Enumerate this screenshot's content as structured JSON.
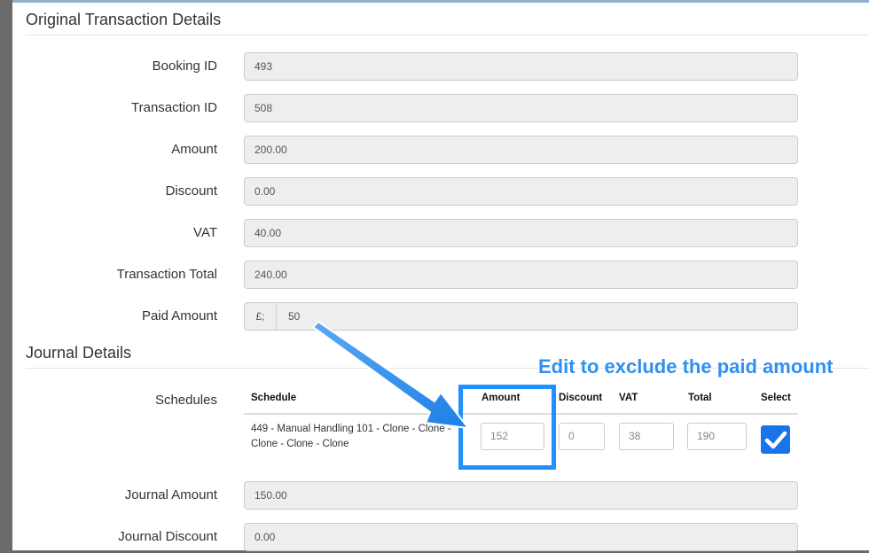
{
  "original": {
    "title": "Original Transaction Details",
    "fields": [
      {
        "label": "Booking ID",
        "value": "493"
      },
      {
        "label": "Transaction ID",
        "value": "508"
      },
      {
        "label": "Amount",
        "value": "200.00"
      },
      {
        "label": "Discount",
        "value": "0.00"
      },
      {
        "label": "VAT",
        "value": "40.00"
      },
      {
        "label": "Transaction Total",
        "value": "240.00"
      }
    ],
    "paid": {
      "label": "Paid Amount",
      "addon": "£;",
      "value": "50"
    }
  },
  "journal": {
    "title": "Journal Details",
    "schedules_label": "Schedules",
    "table": {
      "headers": [
        "Schedule",
        "Amount",
        "Discount",
        "VAT",
        "Total",
        "Select"
      ],
      "row": {
        "schedule": "449 - Manual Handling 101 - Clone - Clone - Clone - Clone - Clone",
        "amount": "152",
        "discount": "0",
        "vat": "38",
        "total": "190",
        "selected": true
      }
    },
    "fields": [
      {
        "label": "Journal Amount",
        "value": "150.00"
      },
      {
        "label": "Journal Discount",
        "value": "0.00"
      }
    ]
  },
  "annotation": {
    "text": "Edit to exclude the paid amount",
    "color": "#2f8ff2"
  },
  "colors": {
    "accent": "#1a73e8",
    "field_bg": "#eeeeee",
    "highlight": "#1e90ff"
  }
}
